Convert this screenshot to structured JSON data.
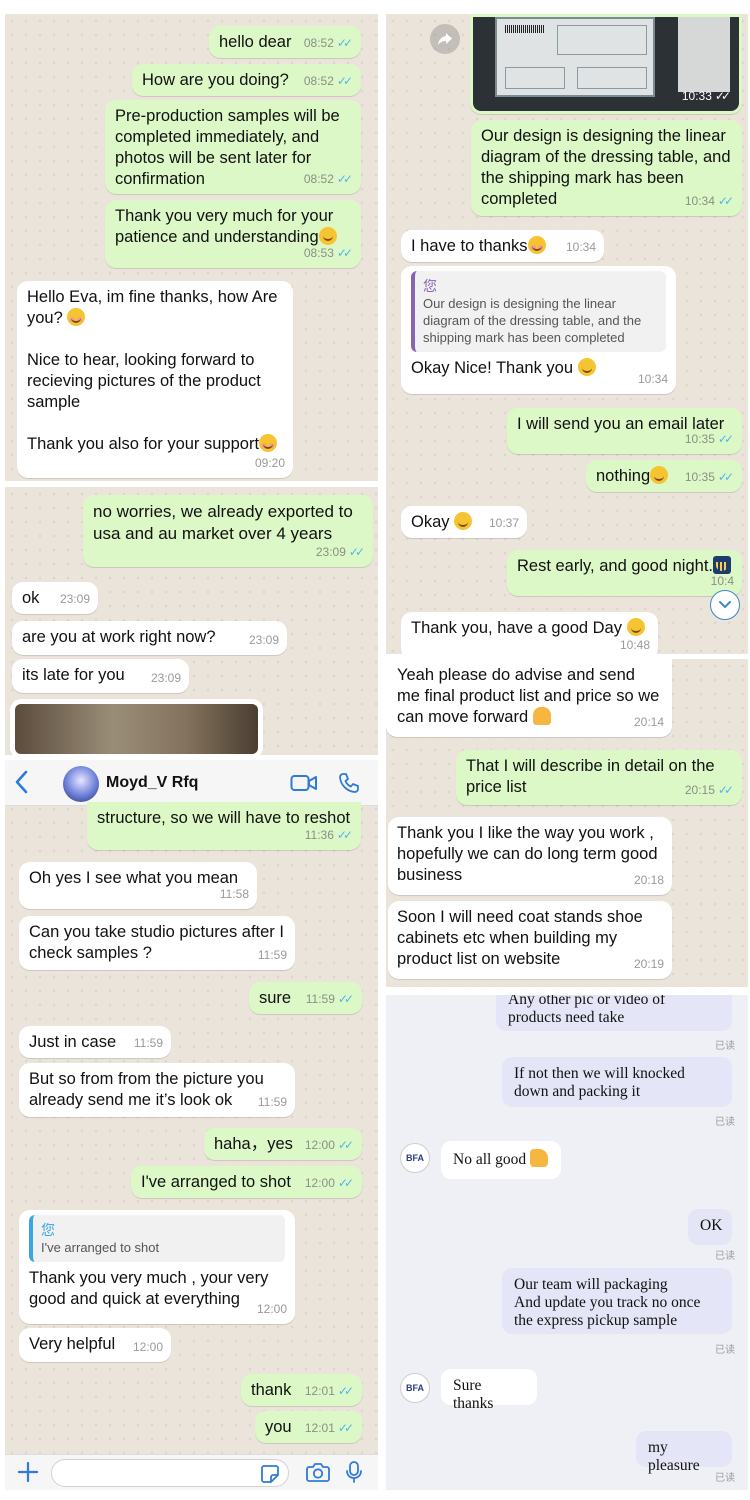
{
  "panel1": {
    "messages": [
      {
        "text": "hello dear",
        "time": "08:52"
      },
      {
        "text": "How are you doing?",
        "time": "08:52"
      },
      {
        "text": "Pre-production samples will be completed immediately, and photos will be sent later for confirmation",
        "time": "08:52"
      },
      {
        "text": "Thank you very much for your patience and understanding",
        "time": "08:53"
      },
      {
        "text": "Hello Eva, im fine thanks, how Are you? ",
        "text2": "Nice to hear, looking forward to recieving pictures of the product sample",
        "text3": "Thank you also for your support",
        "time": "09:20"
      }
    ]
  },
  "panel2": {
    "messages": [
      {
        "text": "no worries, we already exported to usa and au market over 4 years",
        "time": "23:09"
      },
      {
        "text": "ok",
        "time": "23:09"
      },
      {
        "text": "are you at work right now?",
        "time": "23:09"
      },
      {
        "text": "its late for you",
        "time": "23:09"
      }
    ]
  },
  "panel3": {
    "header": {
      "contact_name": "Moyd_V Rfq",
      "back_icon": "chevron-left-icon",
      "video_icon": "video-camera-icon",
      "call_icon": "phone-icon"
    },
    "messages": [
      {
        "text": "structure, so we will have to reshot",
        "time": "11:36"
      },
      {
        "text": "Oh yes I see what you mean",
        "time": "11:58"
      },
      {
        "text": "Can you take studio pictures after I check samples ?",
        "time": "11:59"
      },
      {
        "text": "sure",
        "time": "11:59"
      },
      {
        "text": "Just in case",
        "time": "11:59"
      },
      {
        "text": "But so from from the picture you already send me it’s look ok",
        "time": "11:59"
      },
      {
        "text": "haha，yes",
        "time": "12:00"
      },
      {
        "text": "I've arranged to shot",
        "time": "12:00"
      },
      {
        "quote_name": "您",
        "quote_text": "I've arranged to shot",
        "text": "Thank you very much , your very good and quick at everything",
        "time": "12:00"
      },
      {
        "text": "Very helpful",
        "time": "12:00"
      },
      {
        "text": "thank",
        "time": "12:01"
      },
      {
        "text": "you",
        "time": "12:01"
      }
    ]
  },
  "panel4": {
    "messages": [
      {
        "time": "10:33"
      },
      {
        "text": "Our design is designing the linear diagram of the dressing table, and the shipping mark has been completed",
        "time": "10:34"
      },
      {
        "text": "I have to thanks",
        "time": "10:34"
      },
      {
        "quote_name": "您",
        "quote_text": "Our design is designing the linear diagram of the dressing table, and the shipping mark has been completed",
        "text": "Okay Nice! Thank you ",
        "time": "10:34"
      },
      {
        "text": "I will send you an email later",
        "time": "10:35"
      },
      {
        "text": "nothing",
        "time": "10:35"
      },
      {
        "text": "Okay ",
        "time": "10:37"
      },
      {
        "text": "Rest early, and good night.",
        "time": "10:4"
      },
      {
        "text": "Thank you, have a good Day ",
        "time": "10:48"
      }
    ]
  },
  "panel5": {
    "messages": [
      {
        "text": "Yeah please do advise and send me final product list and price so we can move forward ",
        "time": "20:14"
      },
      {
        "text": "That I will describe in detail on the price list",
        "time": "20:15"
      },
      {
        "text": "Thank you I like the way you work , hopefully we can do long term good business",
        "time": "20:18"
      },
      {
        "text": "Soon I will need coat stands shoe cabinets etc when building my product list on website",
        "time": "20:19"
      }
    ]
  },
  "panel6": {
    "read_label": "已读",
    "avatar_label": "BFA",
    "messages": [
      {
        "text": "Any other pic or video of products need take"
      },
      {
        "text": "If not then we will knocked down and packing it"
      },
      {
        "text": "No all good "
      },
      {
        "text": "OK"
      },
      {
        "text": "Our team will packaging\nAnd update you track no once the express pickup sample"
      },
      {
        "text": "Sure thanks"
      },
      {
        "text": "my pleasure"
      }
    ]
  }
}
